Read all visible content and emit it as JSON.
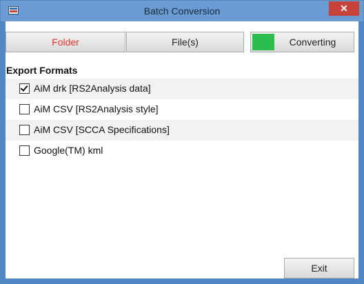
{
  "window": {
    "title": "Batch Conversion",
    "close_glyph": "✕"
  },
  "toolbar": {
    "folder_label": "Folder",
    "files_label": "File(s)",
    "converting_label": "Converting",
    "folder_color": "#e8342c",
    "converting_indicator_color": "#2dbd4f"
  },
  "export": {
    "title": "Export Formats",
    "formats": [
      {
        "label": "AiM drk [RS2Analysis data]",
        "checked": true
      },
      {
        "label": "AiM CSV [RS2Analysis style]",
        "checked": false
      },
      {
        "label": "AiM CSV [SCCA Specifications]",
        "checked": false
      },
      {
        "label": "Google(TM) kml",
        "checked": false
      }
    ]
  },
  "footer": {
    "exit_label": "Exit"
  },
  "icons": {
    "app": "app-logo-icon",
    "close": "close-icon",
    "check": "checkmark-icon"
  }
}
